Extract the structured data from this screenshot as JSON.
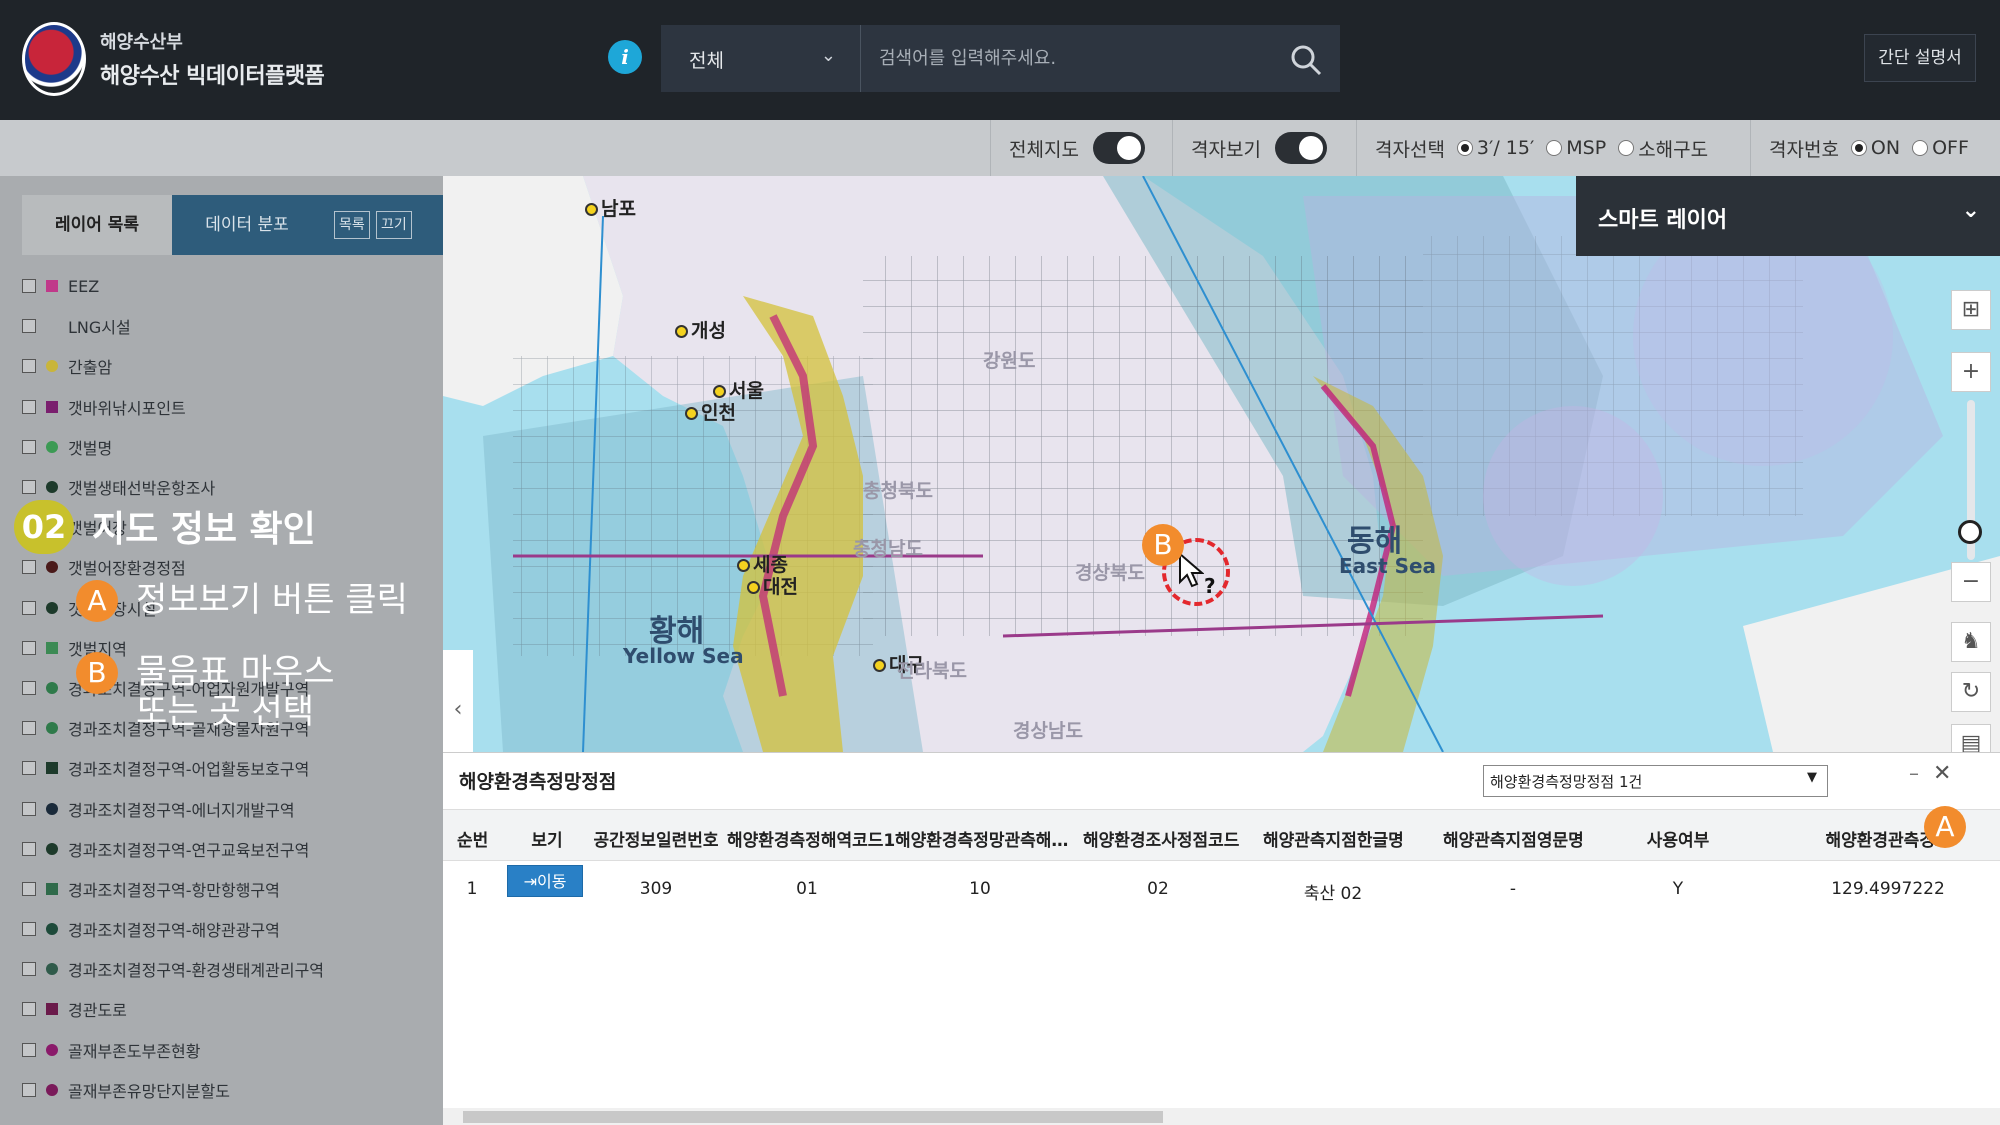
{
  "header": {
    "org": "해양수산부",
    "platform": "해양수산 빅데이터플랫폼",
    "search": {
      "category": "전체",
      "placeholder": "검색어를 입력해주세요."
    },
    "manual_label": "간단 설명서"
  },
  "toolbar": {
    "full_map_label": "전체지도",
    "grid_view_label": "격자보기",
    "grid_select_label": "격자선택",
    "grid_select_options": [
      "3′/ 15′",
      "MSP",
      "소해구도"
    ],
    "grid_number_label": "격자번호",
    "grid_number_options": [
      "ON",
      "OFF"
    ]
  },
  "sidebar": {
    "tabs": [
      "레이어 목록",
      "데이터 분포"
    ],
    "mini_buttons": [
      "목록",
      "끄기"
    ],
    "layers": [
      {
        "label": "EEZ",
        "color": "#c0398a"
      },
      {
        "label": "LNG시설",
        "color": ""
      },
      {
        "label": "간출암",
        "color": "#c9b53a"
      },
      {
        "label": "갯바위낚시포인트",
        "color": "#7a1f6e"
      },
      {
        "label": "갯벌명",
        "color": "#3c9a54"
      },
      {
        "label": "갯벌생태선박운항조사",
        "color": "#1d3a2b"
      },
      {
        "label": "갯벌어장",
        "color": "#4a2a1a"
      },
      {
        "label": "갯벌어장환경정점",
        "color": "#4a1a1a"
      },
      {
        "label": "갯벌어장시설",
        "color": "#1d3a2b"
      },
      {
        "label": "갯벌지역",
        "color": "#3c8a54"
      },
      {
        "label": "경과조치결정구역-어업자원개발구역",
        "color": "#2f7a4a"
      },
      {
        "label": "경과조치결정구역-골재광물자원구역",
        "color": "#2f7a4a"
      },
      {
        "label": "경과조치결정구역-어업활동보호구역",
        "color": "#1d3a2b"
      },
      {
        "label": "경과조치결정구역-에너지개발구역",
        "color": "#1a2a3a"
      },
      {
        "label": "경과조치결정구역-연구교육보전구역",
        "color": "#1d3a2b"
      },
      {
        "label": "경과조치결정구역-항만항행구역",
        "color": "#2f6a4a"
      },
      {
        "label": "경과조치결정구역-해양관광구역",
        "color": "#1d4a3a"
      },
      {
        "label": "경과조치결정구역-환경생태계관리구역",
        "color": "#2f5a4a"
      },
      {
        "label": "경관도로",
        "color": "#6a1a4a"
      },
      {
        "label": "골재부존도부존현황",
        "color": "#8a1a6a"
      },
      {
        "label": "골재부존유망단지분할도",
        "color": "#7a1a5a"
      }
    ]
  },
  "overlay": {
    "step_number": "02",
    "step_title": "지도 정보 확인",
    "a_badge": "A",
    "a_text": "정보보기 버튼 클릭",
    "b_badge": "B",
    "b_text_1": "물음표 마우스",
    "b_text_2": "또는 곳 선택"
  },
  "map": {
    "cities": [
      "남포",
      "개성",
      "서울",
      "인천",
      "세종",
      "대전",
      "대구"
    ],
    "regions": [
      "강원도",
      "충청북도",
      "충청남도",
      "경상북도",
      "전라북도",
      "경상남도"
    ],
    "seas": {
      "west_ko": "황해",
      "west_en": "Yellow Sea",
      "east_ko": "동해",
      "east_en": "East Sea"
    },
    "cursor_hint": "?",
    "smart_layer_title": "스마트 레이어"
  },
  "panel": {
    "title": "해양환경측정망정점",
    "select_value": "해양환경측정망정점 1건",
    "columns": [
      "순번",
      "보기",
      "공간정보일련번호",
      "해양환경측정해역코드1",
      "해양환경측정망관측해…",
      "해양환경조사정점코드",
      "해양관측지점한글명",
      "해양관측지점영문명",
      "사용여부",
      "해양환경관측경도"
    ],
    "rows": [
      {
        "seq": "1",
        "view": "이동",
        "spatial_id": "309",
        "area_code": "01",
        "obs_code": "10",
        "station_code": "02",
        "name_ko": "축산 02",
        "name_en": "-",
        "in_use": "Y",
        "longitude": "129.4997222"
      }
    ]
  },
  "colors": {
    "header_bg": "#1f2429",
    "accent_blue": "#2980c6",
    "badge_orange": "#f28c2d",
    "step_yellow": "#c8c12c",
    "highlight_red": "#e3282d"
  }
}
